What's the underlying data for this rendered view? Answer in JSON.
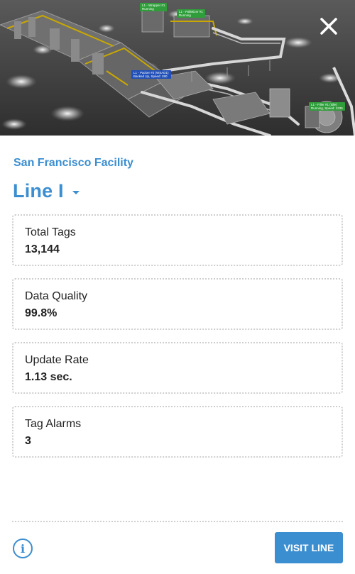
{
  "hero": {
    "image_icon": "factory-floor-3d-image",
    "tags": [
      {
        "text": "L1 - Wrapper #1\nRunning",
        "color": "#2f9e3a"
      },
      {
        "text": "L1 - Palletizer #1\nRunning",
        "color": "#2f9e3a"
      },
      {
        "text": "L1 - Packer #2 (WSAD1)\nBacked Up, Speed: 280",
        "color": "#1f4fb8"
      },
      {
        "text": "L1 - Filler #1 (Idle)\nRunning, Speed: 1236",
        "color": "#2f9e3a"
      }
    ],
    "close_icon": "close-icon"
  },
  "facility": "San Francisco Facility",
  "line": {
    "name": "Line I",
    "caret_icon": "caret-down-icon"
  },
  "stats": [
    {
      "label": "Total Tags",
      "value": "13,144"
    },
    {
      "label": "Data Quality",
      "value": "99.8%"
    },
    {
      "label": "Update Rate",
      "value": "1.13 sec."
    },
    {
      "label": "Tag Alarms",
      "value": "3"
    }
  ],
  "footer": {
    "info_icon": "info-icon",
    "info_glyph": "i",
    "visit_label": "VISIT LINE"
  },
  "colors": {
    "accent": "#3b8ed0",
    "border": "#cfcfcf",
    "text": "#222222"
  }
}
